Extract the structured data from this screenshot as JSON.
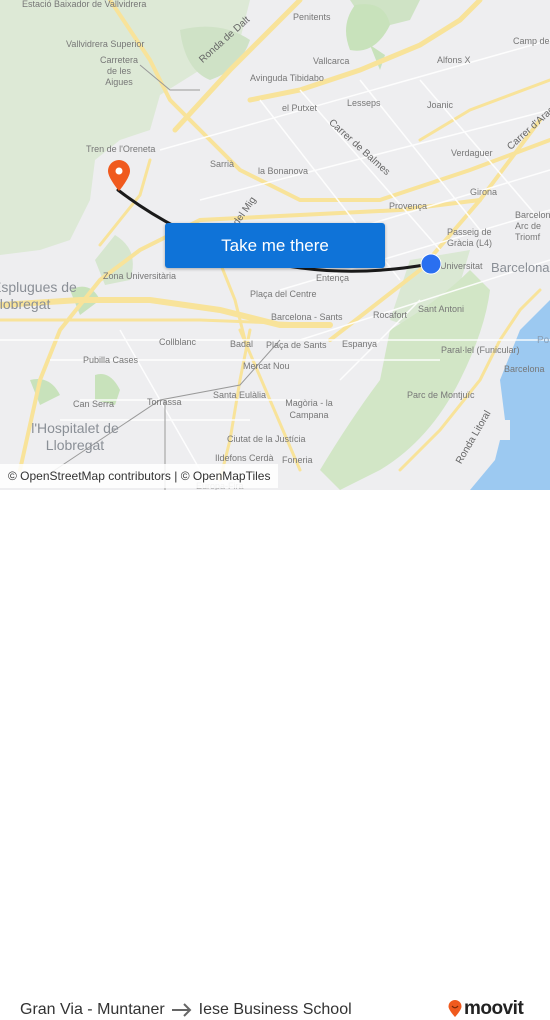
{
  "map": {
    "labels": {
      "estacio_baixador": "Estació Baixador de Vallvidrera",
      "vallvidrera_superior": "Vallvidrera Superior",
      "carretera_aigues": "Carretera de les Aigues",
      "ronda_dalt": "Ronda de Dalt",
      "penitents": "Penitents",
      "vallcarca": "Vallcarca",
      "avinguda_tibidabo": "Avinguda Tibidabo",
      "camp_de": "Camp de l'",
      "alfons_x": "Alfons X",
      "el_putxet": "el Putxet",
      "lesseps": "Lesseps",
      "joanic": "Joanic",
      "carrer_balmes": "Carrer de Balmes",
      "carrer_arago": "Carrer d'Aragó",
      "tren_oreneta": "Tren de l'Oreneta",
      "sarria": "Sarrià",
      "la_bonanova": "la Bonanova",
      "verdaguer": "Verdaguer",
      "girona": "Girona",
      "del_mig": "del Mig",
      "provenca": "Provença",
      "barcelona_arc": "Barcelona Arc de Triomf",
      "passeig_gracia": "Passeig de Gràcia (L4)",
      "universitat": "Universitat",
      "barcelona_city": "Barcelona",
      "esplugues": "Esplugues de Llobregat",
      "zona_universitaria": "Zona Universitària",
      "entenca": "Entença",
      "placa_centre": "Plaça del Centre",
      "barcelona_sants": "Barcelona - Sants",
      "rocafort": "Rocafort",
      "sant_antoni": "Sant Antoni",
      "collblanc": "Collblanc",
      "badal": "Badal",
      "placa_sants": "Plaça de Sants",
      "espanya": "Espanya",
      "pubilla_cases": "Pubilla Cases",
      "mercat_nou": "Mercat Nou",
      "paralel": "Paral·lel (Funicular)",
      "barcelona_station": "Barcelona",
      "can_serra": "Can Serra",
      "torrassa": "Torrassa",
      "santa_eulalia": "Santa Eulàlia",
      "magoria": "Magòria - la Campana",
      "parc_montjuic": "Parc de Montjuïc",
      "hospitalet": "l'Hospitalet de Llobregat",
      "ciutat_justicia": "Ciutat de la Justícia",
      "ronda_litoral": "Ronda Litoral",
      "ildefons": "Ildefons Cerdà",
      "foneria": "Foneria",
      "europa_fira": "Europa-Fira",
      "port": "Po"
    },
    "attribution": "© OpenStreetMap contributors | © OpenMapTiles",
    "cta_label": "Take me there",
    "colors": {
      "origin_marker": "#2a6ff0",
      "destination_marker": "#f05a1e",
      "route_line": "#1a1a1a",
      "cta_background": "#0f73d8"
    }
  },
  "footer": {
    "origin": "Gran Via - Muntaner",
    "destination": "Iese Business School",
    "brand": "moovit",
    "brand_color": "#f05a1e"
  }
}
